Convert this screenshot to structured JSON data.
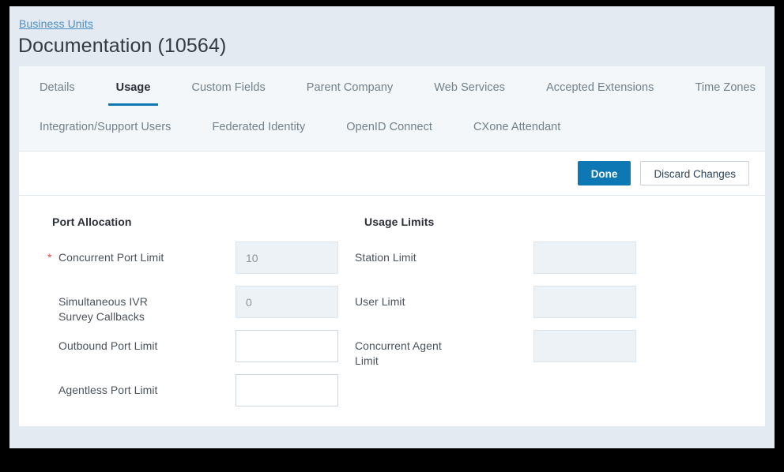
{
  "header": {
    "breadcrumb": "Business Units",
    "title": "Documentation (10564)"
  },
  "tabs": {
    "row1": [
      {
        "label": "Details",
        "active": false
      },
      {
        "label": "Usage",
        "active": true
      },
      {
        "label": "Custom Fields",
        "active": false
      },
      {
        "label": "Parent Company",
        "active": false
      },
      {
        "label": "Web Services",
        "active": false
      },
      {
        "label": "Accepted Extensions",
        "active": false
      },
      {
        "label": "Time Zones",
        "active": false
      }
    ],
    "row2": [
      {
        "label": "Integration/Support Users",
        "active": false
      },
      {
        "label": "Federated Identity",
        "active": false
      },
      {
        "label": "OpenID Connect",
        "active": false
      },
      {
        "label": "CXone Attendant",
        "active": false
      }
    ]
  },
  "actions": {
    "done_label": "Done",
    "discard_label": "Discard Changes"
  },
  "form": {
    "left_section_title": "Port Allocation",
    "right_section_title": "Usage Limits",
    "left_fields": [
      {
        "label": "Concurrent Port Limit",
        "required": true,
        "value": "10",
        "disabled": true
      },
      {
        "label": "Simultaneous IVR\nSurvey Callbacks",
        "label_line1": "Simultaneous IVR",
        "label_line2": "Survey Callbacks",
        "required": false,
        "value": "0",
        "disabled": true
      },
      {
        "label": "Outbound Port Limit",
        "required": false,
        "value": "",
        "disabled": false
      },
      {
        "label": "Agentless Port Limit",
        "required": false,
        "value": "",
        "disabled": false
      }
    ],
    "right_fields": [
      {
        "label": "Station Limit",
        "required": false,
        "value": "",
        "disabled": true
      },
      {
        "label": "User Limit",
        "required": false,
        "value": "",
        "disabled": true
      },
      {
        "label": "Concurrent Agent\nLimit",
        "label_line1": "Concurrent Agent",
        "label_line2": "Limit",
        "required": false,
        "value": "",
        "disabled": true
      }
    ],
    "required_marker": "*"
  },
  "colors": {
    "accent": "#0d78b4",
    "link": "#4b90c4",
    "page_background": "#e3eaf2",
    "tab_background": "#f3f7f9",
    "required_star": "#e0463d",
    "disabled_field": "#edf2f6"
  }
}
